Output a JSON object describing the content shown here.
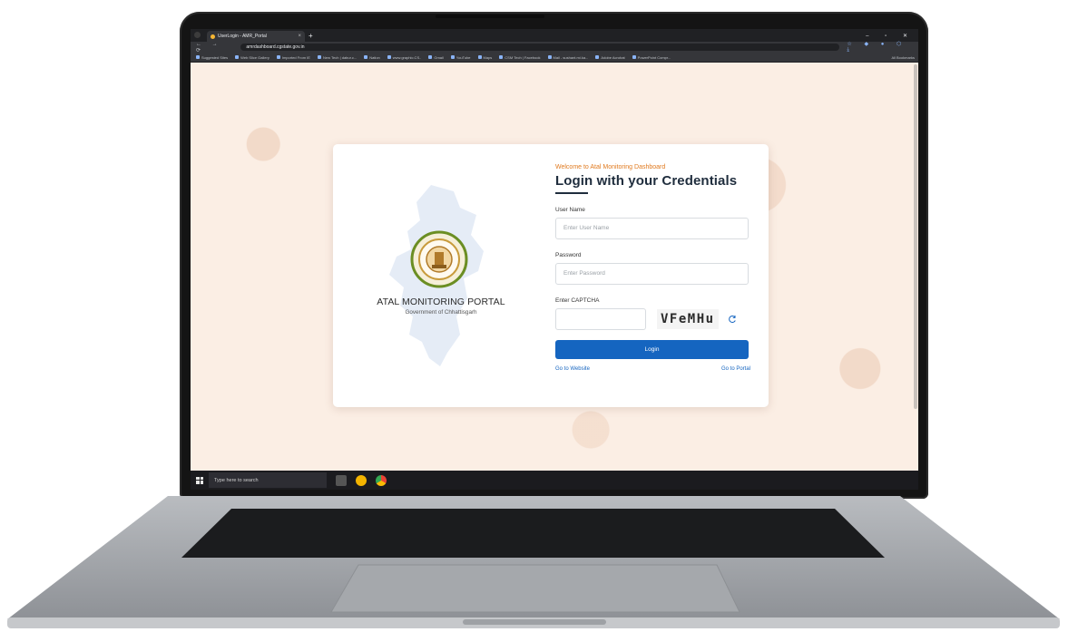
{
  "browser": {
    "tab_title": "UserLogin - AMR_Portal",
    "tab_close": "×",
    "new_tab": "+",
    "window_controls": "– ▫ ✕",
    "nav_buttons": "← → ⟳",
    "url": "amrdashboard.cgstate.gov.in",
    "toolbar_icons": "☆ ◆ ● ⬡ ⤓",
    "bookmarks": [
      "Suggested Sites",
      "Web Slice Gallery",
      "Imported From IE",
      "New Tech | dabur.c...",
      "Nation",
      "www.graphic.CS..",
      "Gmail",
      "YouTube",
      "Maps",
      "CSM Tech | Facebook",
      "Mail - sushant.mi.ka...",
      "Adobe Acrobat",
      "PowerPoint Compr..."
    ],
    "all_bookmarks": "All Bookmarks"
  },
  "login": {
    "welcome": "Welcome to Atal Monitoring Dashboard",
    "heading": "Login with your Credentials",
    "username_label": "User Name",
    "username_placeholder": "Enter User Name",
    "password_label": "Password",
    "password_placeholder": "Enter Password",
    "captcha_label": "Enter CAPTCHA",
    "captcha_code": "VFeMHu",
    "login_button": "Login",
    "go_to_website": "Go to Website",
    "go_to_portal": "Go to Portal"
  },
  "brand": {
    "title": "ATAL MONITORING PORTAL",
    "subtitle": "Government of Chhattisgarh"
  },
  "taskbar": {
    "search_placeholder": "Type here to search"
  },
  "colors": {
    "accent": "#1565c0",
    "welcome": "#e07a1f",
    "page_bg": "#fbeee4"
  }
}
